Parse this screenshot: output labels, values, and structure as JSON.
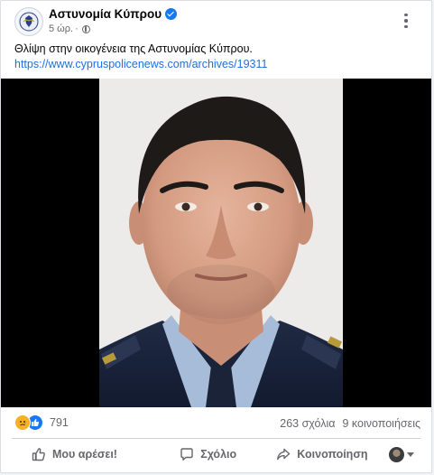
{
  "post": {
    "page_name": "Αστυνομία Κύπρου",
    "timestamp": "5 ώρ.",
    "separator": "·",
    "text": "Θλίψη στην οικογένεια της Αστυνομίας Κύπρου.",
    "link": "https://www.cypruspolicenews.com/archives/19311"
  },
  "engagement": {
    "reaction_count": "791",
    "comments": "263 σχόλια",
    "shares": "9 κοινοποιήσεις"
  },
  "actions": {
    "like": "Μου αρέσει!",
    "comment": "Σχόλιο",
    "share": "Κοινοποίηση"
  },
  "icons": {
    "verified": "verified-badge-icon",
    "audience": "globe-icon",
    "more": "more-options-icon",
    "reaction_sad": "sad-reaction-icon",
    "reaction_like": "like-reaction-icon"
  },
  "colors": {
    "accent": "#1877f2",
    "link": "#216fdb",
    "muted": "#65676b",
    "sad": "#f7b125"
  }
}
